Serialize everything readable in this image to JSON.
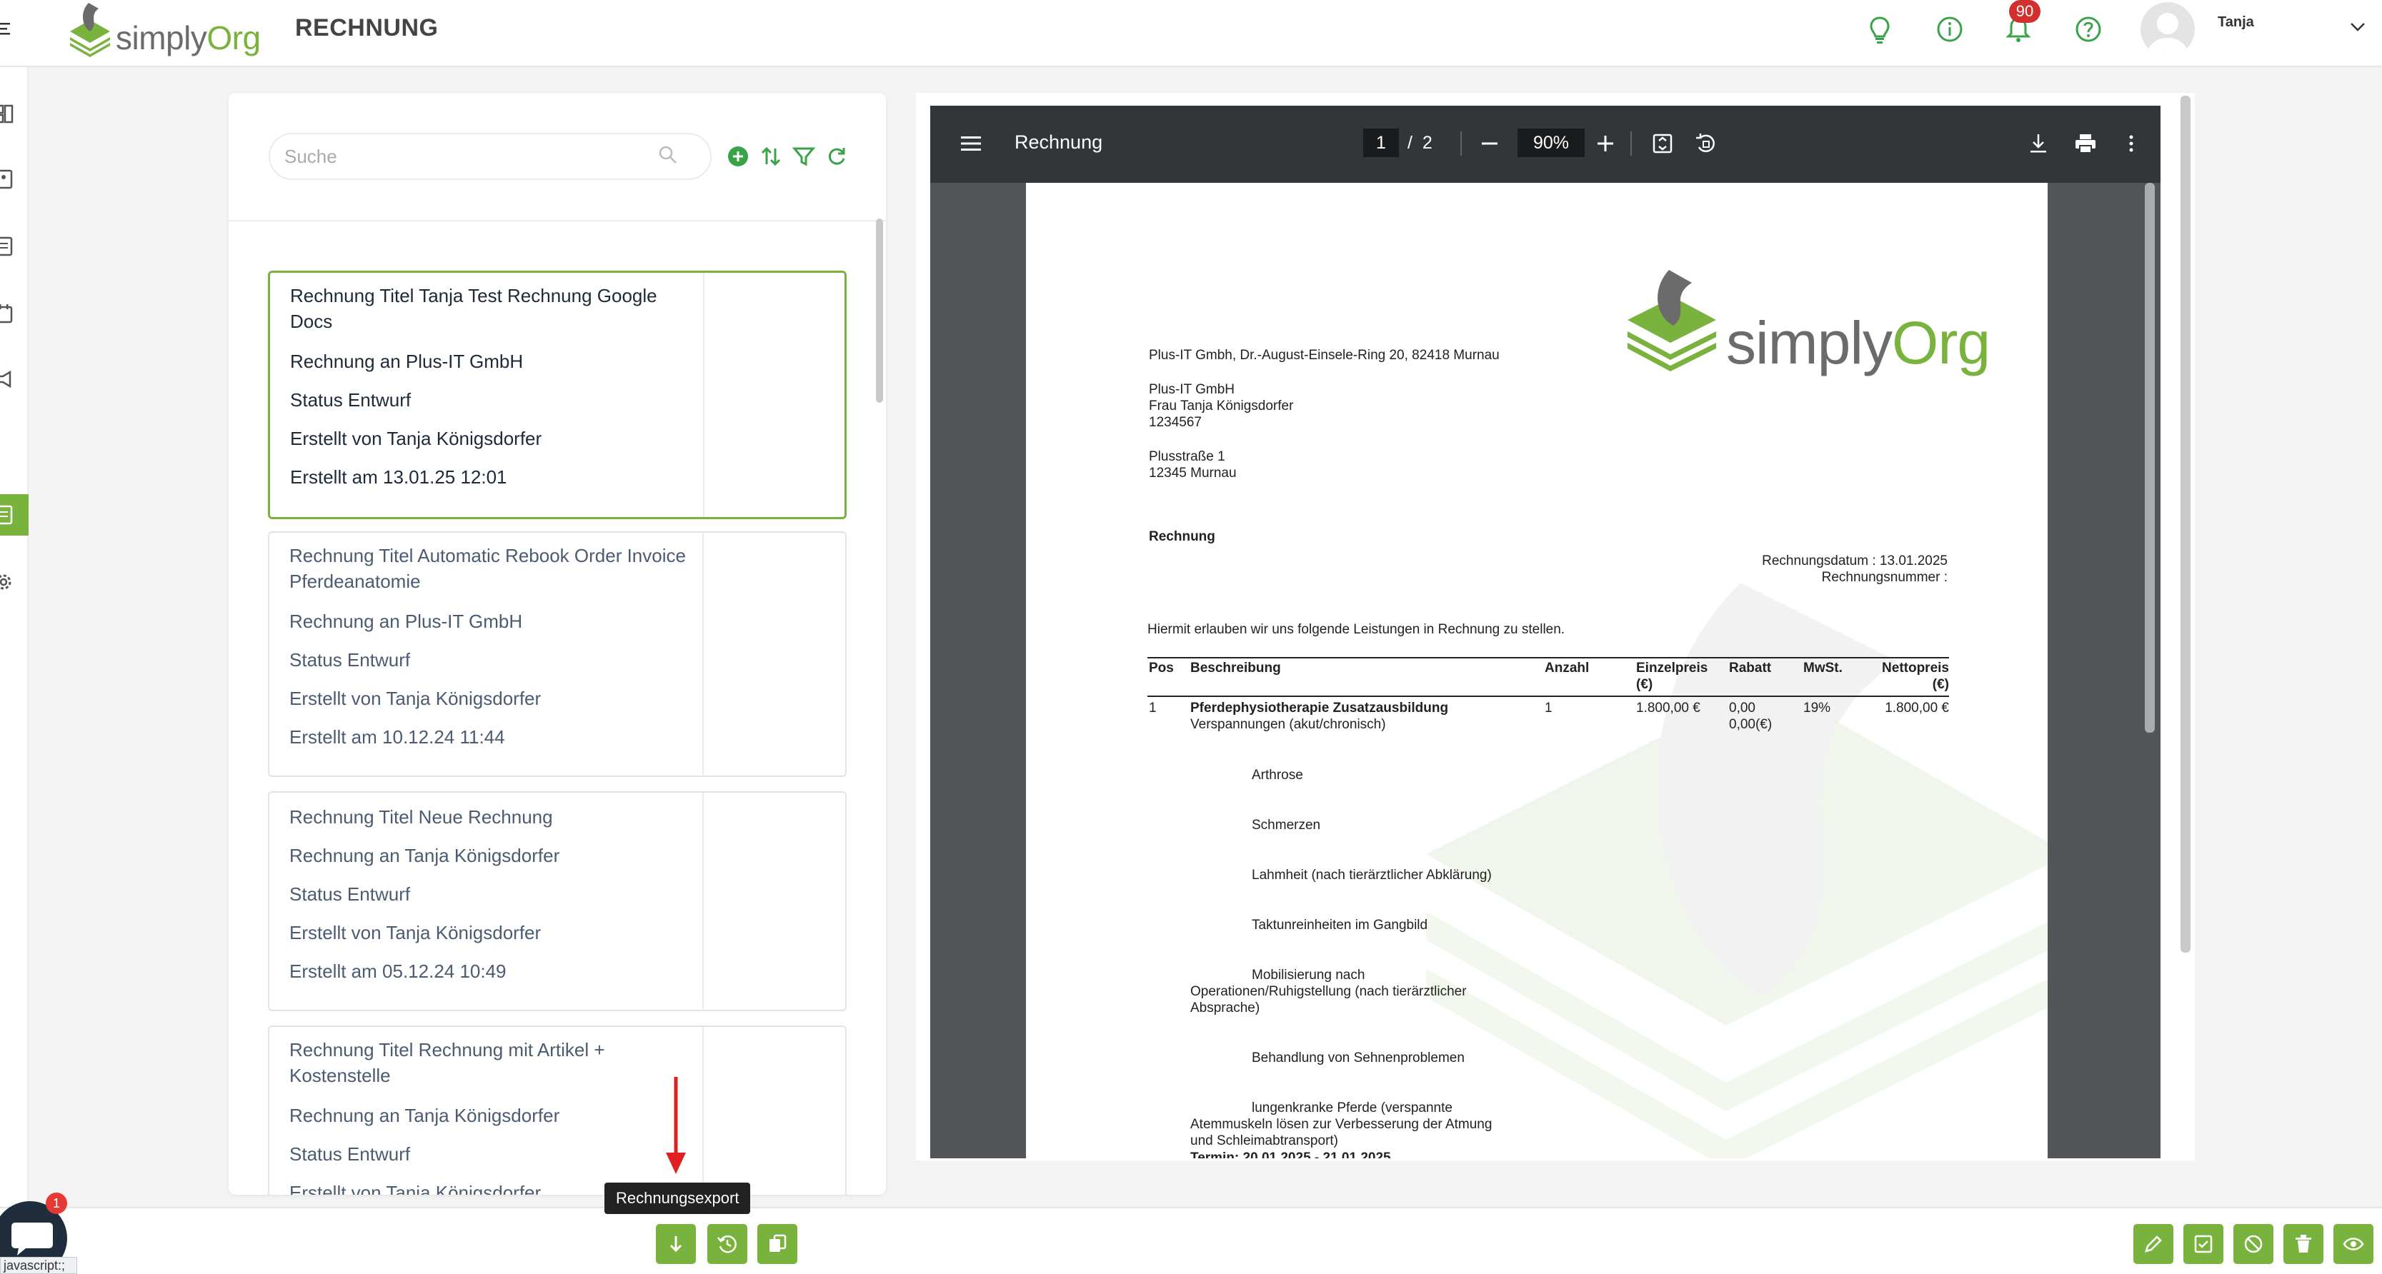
{
  "app": {
    "logo_word1": "simply",
    "logo_word2": "Org",
    "page_title": "RECHNUNG",
    "brand_color": "#7ab23e"
  },
  "topbar": {
    "icons": [
      "lightbulb-icon",
      "info-icon",
      "bell-icon",
      "help-icon"
    ],
    "notifications_count": "90",
    "user_name": "Tanja"
  },
  "list": {
    "search_placeholder": "Suche",
    "cards": [
      {
        "title": "Rechnung Titel Tanja Test Rechnung Google Docs",
        "to": "Rechnung an Plus-IT GmbH",
        "status": "Status Entwurf",
        "created_by": "Erstellt von Tanja Königsdorfer",
        "created_at": "Erstellt am 13.01.25 12:01"
      },
      {
        "title": "Rechnung Titel Automatic Rebook Order Invoice Pferdeanatomie",
        "to": "Rechnung an Plus-IT GmbH",
        "status": "Status Entwurf",
        "created_by": "Erstellt von Tanja Königsdorfer",
        "created_at": "Erstellt am 10.12.24 11:44"
      },
      {
        "title": "Rechnung Titel Neue Rechnung",
        "to": "Rechnung an Tanja Königsdorfer",
        "status": "Status Entwurf",
        "created_by": "Erstellt von Tanja Königsdorfer",
        "created_at": "Erstellt am 05.12.24 10:49"
      },
      {
        "title": "Rechnung Titel Rechnung mit Artikel + Kostenstelle",
        "to": "Rechnung an Tanja Königsdorfer",
        "status": "Status Entwurf",
        "created_by": "Erstellt von Tanja Königsdorfer",
        "created_at": ""
      }
    ]
  },
  "viewer": {
    "title": "Rechnung",
    "page_current": "1",
    "page_sep": "/",
    "page_total": "2",
    "zoom": "90%"
  },
  "invoice": {
    "sender_line": "Plus-IT Gmbh, Dr.-August-Einsele-Ring 20, 82418 Murnau",
    "recipient": [
      "Plus-IT GmbH",
      "Frau Tanja Königsdorfer",
      "1234567"
    ],
    "address": [
      "Plusstraße 1",
      "12345 Murnau"
    ],
    "heading": "Rechnung",
    "date_line": "Rechnungsdatum : 13.01.2025",
    "number_line": "Rechnungsnummer :",
    "intro": "Hiermit erlauben wir uns folgende Leistungen in Rechnung zu stellen.",
    "headers": {
      "pos": "Pos",
      "desc": "Beschreibung",
      "qty": "Anzahl",
      "unit_price": "Einzelpreis",
      "unit_price_cur": "(€)",
      "discount": "Rabatt",
      "vat": "MwSt.",
      "net": "Nettopreis",
      "net_cur": "(€)"
    },
    "row": {
      "pos": "1",
      "title": "Pferdephysiotherapie Zusatzausbildung",
      "subtitle": "Verspannungen (akut/chronisch)",
      "qty": "1",
      "unit_price": "1.800,00 €",
      "discount1": "0,00",
      "discount2": "0,00(€)",
      "vat": "19%",
      "net": "1.800,00 €"
    },
    "items": [
      "Arthrose",
      "Schmerzen",
      "Lahmheit (nach tierärztlicher Abklärung)",
      "Taktunreinheiten im Gangbild",
      "Mobilisierung nach",
      "Behandlung von Sehnenproblemen",
      "lungenkranke Pferde (verspannte"
    ],
    "item5_cont1": "Operationen/Ruhigstellung (nach tierärztlicher",
    "item5_cont2": "Absprache)",
    "item7_cont1": "Atemmuskeln lösen zur Verbesserung der Atmung",
    "item7_cont2": "und Schleimabtransport)",
    "termin": "Termin: 20.01.2025 - 21.01.2025"
  },
  "bottombar": {
    "tooltip": "Rechnungsexport",
    "chat_badge": "1",
    "js_chip": "javascript:;"
  }
}
